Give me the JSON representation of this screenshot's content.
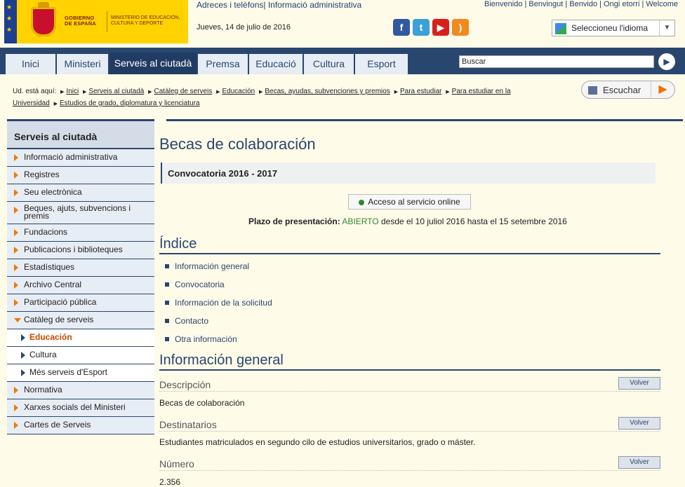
{
  "header": {
    "gov_name": "GOBIERNO DE ESPAÑA",
    "ministry_name": "MINISTERIO DE EDUCACIÓN, CULTURA Y DEPORTE",
    "adreces": "Adreces i telèfons| Informació administrativa",
    "languages": "Bienvenido | Benvingut | Benvido | Ongi etorri | Welcome",
    "date": "Jueves, 14 de julio de 2016",
    "social": [
      "facebook-icon",
      "twitter-icon",
      "youtube-icon",
      "rss-icon"
    ],
    "language_select": "Seleccioneu l'idioma"
  },
  "nav": {
    "tabs": [
      "Inici",
      "Ministeri",
      "Serveis al ciutadà",
      "Premsa",
      "Educació",
      "Cultura",
      "Esport"
    ],
    "active": "Serveis al ciutadà",
    "search_placeholder": "Buscar"
  },
  "breadcrumb": {
    "prefix": "Ud. está aquí:",
    "items": [
      "Inici",
      "Serveis al ciutadà",
      "Catàleg de serveis",
      "Educación",
      "Becas, ayudas, subvenciones y premios",
      "Para estudiar",
      "Para estudiar en la Universidad",
      "Estudios de grado, diplomatura y licenciatura"
    ]
  },
  "escuchar": "Escuchar",
  "sidebar": {
    "title": "Serveis al ciutadà",
    "items": [
      {
        "label": "Informació administrativa"
      },
      {
        "label": "Registres"
      },
      {
        "label": "Seu electrònica"
      },
      {
        "label": "Beques, ajuts, subvencions i premis"
      },
      {
        "label": "Fundacions"
      },
      {
        "label": "Publicacions i biblioteques"
      },
      {
        "label": "Estadístiques"
      },
      {
        "label": "Archivo Central"
      },
      {
        "label": "Participació pública"
      },
      {
        "label": "Catàleg de serveis"
      },
      {
        "label": "Educación"
      },
      {
        "label": "Cultura"
      },
      {
        "label": "Més serveis d'Esport"
      },
      {
        "label": "Normativa"
      },
      {
        "label": "Xarxes socials del Ministeri"
      },
      {
        "label": "Cartes de Serveis"
      }
    ]
  },
  "main": {
    "title": "Becas de colaboración",
    "convocatoria": "Convocatoria 2016 - 2017",
    "online_button": "Acceso al servicio online",
    "plazo_label": "Plazo de presentación:",
    "plazo_status": "ABIERTO",
    "plazo_dates": "desde el 10 juliol 2016 hasta el 15 setembre 2016",
    "index_title": "Índice",
    "index_items": [
      "Información general",
      "Convocatoria",
      "Información de la solicitud",
      "Contacto",
      "Otra información"
    ],
    "info_title": "Información general",
    "volver": "Volver",
    "sections": [
      {
        "title": "Descripción",
        "body": "Becas de colaboración"
      },
      {
        "title": "Destinatarios",
        "body": "Estudiantes matriculados en segundo cilo de estudios universitarios, grado o máster."
      },
      {
        "title": "Número",
        "body": "2.356"
      }
    ]
  }
}
